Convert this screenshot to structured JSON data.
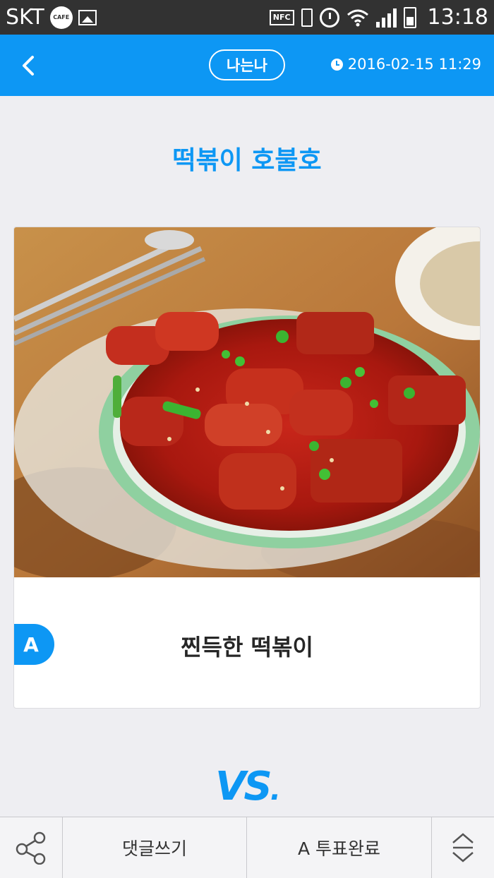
{
  "status_bar": {
    "carrier": "SKT",
    "cafe_badge": "CAFE",
    "nfc_label": "NFC",
    "time": "13:18",
    "icons": [
      "cafe-icon",
      "gallery-icon",
      "nfc-icon",
      "vibrate-icon",
      "alarm-icon",
      "wifi-icon",
      "signal-icon",
      "battery-icon"
    ]
  },
  "header": {
    "back_icon": "chevron-left-icon",
    "author": "나는나",
    "date": "2016-02-15 11:29",
    "date_icon": "clock-icon"
  },
  "main": {
    "title": "떡볶이 호불호",
    "option": {
      "badge": "A",
      "label": "찐득한 떡볶이",
      "image": "tteokbokki-photo"
    },
    "vs": "VS",
    "vs_dot": "."
  },
  "bottom_bar": {
    "share_icon": "share-icon",
    "comment_label": "댓글쓰기",
    "vote_done_label": "A 투표완료",
    "scroll_icon": "up-down-chevron-icon"
  },
  "colors": {
    "accent": "#0d97f4",
    "status_bar": "#323232",
    "background": "#eeeef2",
    "text": "#262626"
  }
}
